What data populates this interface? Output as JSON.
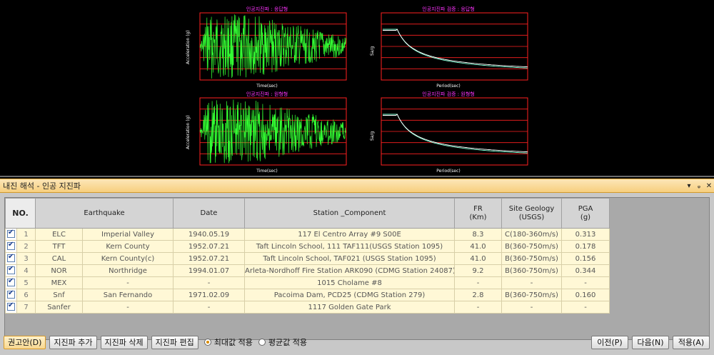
{
  "plots": {
    "top_left": {
      "title": "인공지진파 : 응답형",
      "xlabel": "Time(sec)",
      "ylabel": "Acceleration (g)"
    },
    "top_right": {
      "title": "인공지진파 검증 : 응답형",
      "xlabel": "Period(sec)",
      "ylabel": "Sa/g"
    },
    "bottom_left": {
      "title": "인공지진파 : 원형형",
      "xlabel": "Time(sec)",
      "ylabel": "Acceleration (g)"
    },
    "bottom_right": {
      "title": "인공지진파 검증 : 원형형",
      "xlabel": "Period(sec)",
      "ylabel": "Sa/g"
    }
  },
  "colors": {
    "plot_border": "#ff2020",
    "waveform": "#33ff33",
    "spectrum": "#7fffd4",
    "header_bg": "#f7cf7e"
  },
  "panel": {
    "title": "내진 해석 - 인공 지진파",
    "header_buttons": [
      "▾",
      "ᵩ",
      "✕"
    ]
  },
  "table": {
    "headers": {
      "no": "NO.",
      "earthquake": "Earthquake",
      "date": "Date",
      "station": "Station _Component",
      "fr": "FR\n(Km)",
      "fr_line1": "FR",
      "fr_line2": "(Km)",
      "site_line1": "Site Geology",
      "site_line2": "(USGS)",
      "pga_line1": "PGA",
      "pga_line2": "(g)"
    },
    "rows": [
      {
        "no": "1",
        "code": "ELC",
        "name": "Imperial Valley",
        "date": "1940.05.19",
        "station": "117 El Centro Array #9 S00E",
        "fr": "8.3",
        "site": "C(180-360m/s)",
        "pga": "0.313"
      },
      {
        "no": "2",
        "code": "TFT",
        "name": "Kern County",
        "date": "1952.07.21",
        "station": "Taft Lincoln School, 111 TAF111(USGS Station 1095)",
        "fr": "41.0",
        "site": "B(360-750m/s)",
        "pga": "0.178"
      },
      {
        "no": "3",
        "code": "CAL",
        "name": "Kern County(c)",
        "date": "1952.07.21",
        "station": "Taft Lincoln School, TAF021 (USGS Station 1095)",
        "fr": "41.0",
        "site": "B(360-750m/s)",
        "pga": "0.156"
      },
      {
        "no": "4",
        "code": "NOR",
        "name": "Northridge",
        "date": "1994.01.07",
        "station": "Arleta-Nordhoff Fire Station ARK090 (CDMG Station 24087)",
        "fr": "9.2",
        "site": "B(360-750m/s)",
        "pga": "0.344"
      },
      {
        "no": "5",
        "code": "MEX",
        "name": "-",
        "date": "-",
        "station": "1015 Cholame #8",
        "fr": "-",
        "site": "-",
        "pga": "-"
      },
      {
        "no": "6",
        "code": "Snf",
        "name": "San Fernando",
        "date": "1971.02.09",
        "station": "Pacoima Dam, PCD25 (CDMG Station 279)",
        "fr": "2.8",
        "site": "B(360-750m/s)",
        "pga": "0.160"
      },
      {
        "no": "7",
        "code": "Sanfer",
        "name": "-",
        "date": "-",
        "station": "1117 Golden Gate Park",
        "fr": "-",
        "site": "-",
        "pga": "-"
      }
    ]
  },
  "bottom": {
    "recommend": "권고안(D)",
    "add": "지진파 추가",
    "delete": "지진파 삭제",
    "edit": "지진파 편집",
    "radio_max": "최대값 적용",
    "radio_avg": "평균값 적용",
    "prev": "이전(P)",
    "next": "다음(N)",
    "apply": "적용(A)"
  }
}
